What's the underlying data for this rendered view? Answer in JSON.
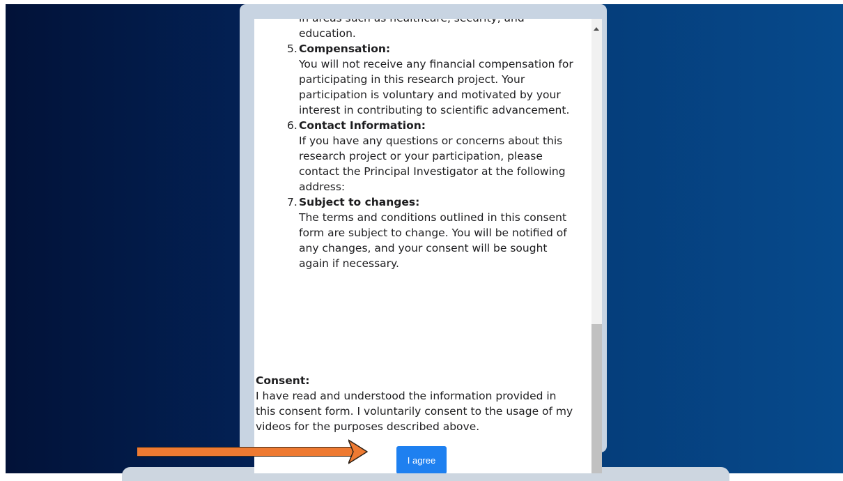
{
  "consent_list": {
    "partial_item_top_line": "in areas such as healthcare, security, and",
    "partial_item_tail": "education.",
    "items": [
      {
        "number": "5.",
        "title": "Compensation:",
        "body": "You will not receive any financial compensation for participating in this research project. Your participation is voluntary and motivated by your interest in contributing to scientific advancement."
      },
      {
        "number": "6.",
        "title": "Contact Information:",
        "body": "If you have any questions or concerns about this research project or your participation, please contact the Principal Investigator at the following address:"
      },
      {
        "number": "7.",
        "title": "Subject to changes:",
        "body": "The terms and conditions outlined in this consent form are subject to change. You will be notified of any changes, and your consent will be sought again if necessary."
      }
    ]
  },
  "consent": {
    "title": "Consent:",
    "text": "I have read and understood the information provided in this consent form. I voluntarily consent to the usage of my videos for the purposes described above."
  },
  "agree_button": {
    "label": "I agree"
  },
  "colors": {
    "accent": "#1e80f0",
    "arrow": "#ee7a32",
    "background_left": "#021238",
    "background_right": "#064a8c",
    "card": "#c8d4e2"
  },
  "icons": {
    "scroll_up": "triangle-up",
    "annotation": "right-arrow"
  }
}
